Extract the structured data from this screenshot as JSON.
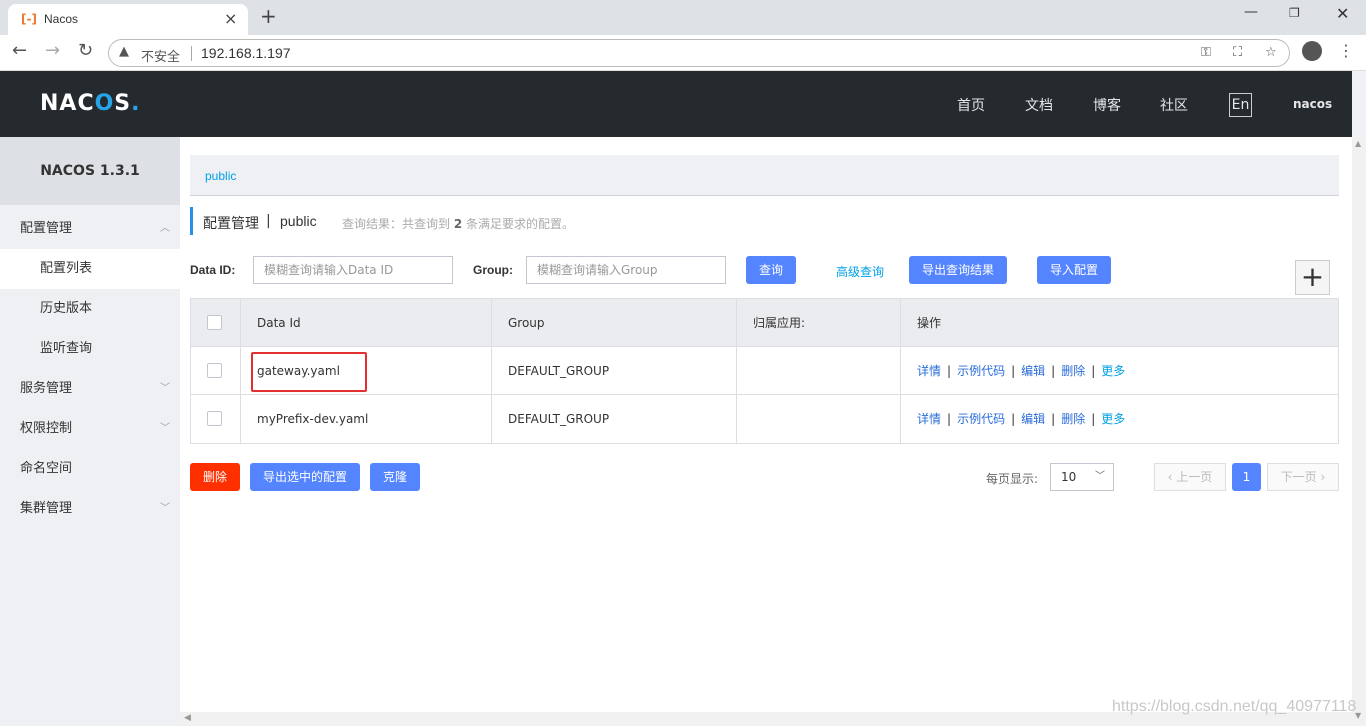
{
  "browser": {
    "tab_title": "Nacos",
    "tab_favicon": "nacos-favicon",
    "security_label": "不安全",
    "url": "192.168.1.197"
  },
  "header": {
    "logo_parts": [
      "NAC",
      "O",
      "S",
      "."
    ],
    "nav": [
      "首页",
      "文档",
      "博客",
      "社区"
    ],
    "lang": "En",
    "user": "nacos"
  },
  "sidebar": {
    "version": "NACOS 1.3.1",
    "items": [
      {
        "label": "配置管理",
        "chevron": "︿"
      },
      {
        "label": "配置列表"
      },
      {
        "label": "历史版本"
      },
      {
        "label": "监听查询"
      },
      {
        "label": "服务管理",
        "chevron": "﹀"
      },
      {
        "label": "权限控制",
        "chevron": "﹀"
      },
      {
        "label": "命名空间"
      },
      {
        "label": "集群管理",
        "chevron": "﹀"
      }
    ]
  },
  "main": {
    "namespace": "public",
    "title": "配置管理",
    "title_sep": "|",
    "title_ns": "public",
    "result_hint_prefix": "查询结果：共查询到",
    "result_count": "2",
    "result_hint_suffix": "条满足要求的配置。",
    "filters": {
      "dataid_label": "Data ID:",
      "dataid_placeholder": "模糊查询请输入Data ID",
      "group_label": "Group:",
      "group_placeholder": "模糊查询请输入Group",
      "query_btn": "查询",
      "advanced": "高级查询",
      "export_btn": "导出查询结果",
      "import_btn": "导入配置",
      "add_btn": "+"
    },
    "table": {
      "columns": [
        "Data Id",
        "Group",
        "归属应用:",
        "操作"
      ],
      "rows": [
        {
          "data_id": "gateway.yaml",
          "group": "DEFAULT_GROUP",
          "app": "",
          "highlighted": true
        },
        {
          "data_id": "myPrefix-dev.yaml",
          "group": "DEFAULT_GROUP",
          "app": "",
          "highlighted": false
        }
      ],
      "actions": [
        "详情",
        "示例代码",
        "编辑",
        "删除",
        "更多"
      ],
      "action_sep": "|"
    },
    "bottom": {
      "delete_btn": "删除",
      "export_selected_btn": "导出选中的配置",
      "clone_btn": "克隆",
      "page_size_label": "每页显示:",
      "page_size": "10",
      "prev": "上一页",
      "current_page": "1",
      "next": "下一页"
    }
  },
  "watermark": "https://blog.csdn.net/qq_40977118",
  "colors": {
    "header_bg": "#252a2f",
    "primary": "#5584ff",
    "danger": "#ff3000",
    "link": "#00a0e9",
    "highlight": "#e52e2e"
  }
}
